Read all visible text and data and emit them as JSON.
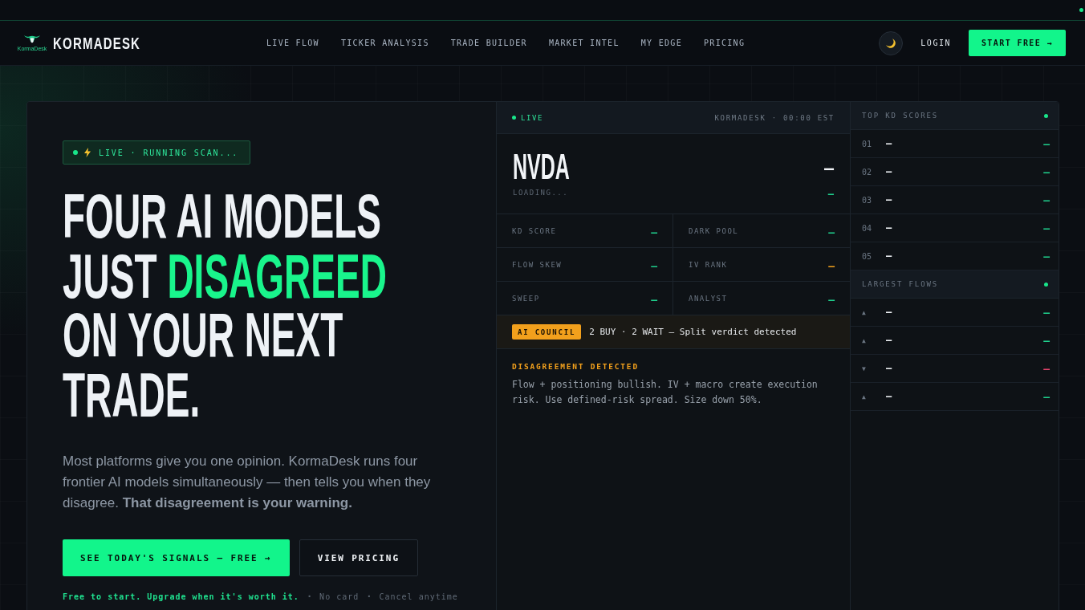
{
  "nav": {
    "logo_caption": "KormaDesk",
    "brand": "KORMADESK",
    "links": [
      {
        "label": "LIVE FLOW"
      },
      {
        "label": "TICKER ANALYSIS"
      },
      {
        "label": "TRADE BUILDER"
      },
      {
        "label": "MARKET INTEL"
      },
      {
        "label": "MY EDGE"
      },
      {
        "label": "PRICING"
      }
    ],
    "login": "LOGIN",
    "cta": "START FREE →"
  },
  "hero": {
    "badge": "LIVE · RUNNING SCAN...",
    "headline": [
      {
        "text": "FOUR AI MODELS JUST",
        "highlight": false
      },
      {
        "text": "DISAGREED",
        "highlight": true
      },
      {
        "text": "ON YOUR NEXT TRADE.",
        "highlight": false
      }
    ],
    "description": "Most platforms give you one opinion. KormaDesk runs four frontier AI models simultaneously — then tells you when they disagree. **That disagreement is your warning.**",
    "buttons": [
      {
        "label": "SEE TODAY'S SIGNALS — FREE →",
        "kind": "primary"
      },
      {
        "label": "VIEW PRICING",
        "kind": "secondary"
      }
    ],
    "notes": [
      {
        "text": "Free to start. Upgrade when it's worth it.",
        "kind": "highlight"
      },
      {
        "text": "No card",
        "kind": "muted"
      },
      {
        "text": "Cancel anytime",
        "kind": "muted"
      }
    ],
    "note_separator": "·"
  },
  "ticker_card": {
    "status": "LIVE",
    "source": "KORMADESK · 00:00 EST",
    "symbol": "NVDA",
    "subtitle": "LOADING...",
    "price": "—",
    "change": "—"
  },
  "metrics": [
    {
      "label": "KD SCORE",
      "value": "—",
      "color": "#1fcf8c"
    },
    {
      "label": "DARK POOL",
      "value": "—",
      "color": "#1fcf8c"
    },
    {
      "label": "FLOW SKEW",
      "value": "—",
      "color": "#1fcf8c"
    },
    {
      "label": "IV RANK",
      "value": "—",
      "color": "#f2a01c"
    },
    {
      "label": "SWEEP",
      "value": "—",
      "color": "#1fcf8c"
    },
    {
      "label": "ANALYST",
      "value": "—",
      "color": "#1fcf8c"
    }
  ],
  "council": {
    "badge": "AI COUNCIL",
    "verdict": "2 BUY · 2 WAIT — Split verdict detected"
  },
  "alert": {
    "title": "DISAGREEMENT DETECTED",
    "text": "Flow + positioning bullish. IV + macro create execution risk. Use defined-risk spread. Size down 50%."
  },
  "top_scores": {
    "title": "TOP KD SCORES",
    "rows": [
      {
        "rank": "01",
        "symbol": "—",
        "score": "—"
      },
      {
        "rank": "02",
        "symbol": "—",
        "score": "—"
      },
      {
        "rank": "03",
        "symbol": "—",
        "score": "—"
      },
      {
        "rank": "04",
        "symbol": "—",
        "score": "—"
      },
      {
        "rank": "05",
        "symbol": "—",
        "score": "—"
      }
    ]
  },
  "largest_flows": {
    "title": "LARGEST FLOWS",
    "rows": [
      {
        "arrow": "▲",
        "symbol": "—",
        "value": "—",
        "color": "#1fcf8c"
      },
      {
        "arrow": "▲",
        "symbol": "—",
        "value": "—",
        "color": "#1fcf8c"
      },
      {
        "arrow": "▼",
        "symbol": "—",
        "value": "—",
        "color": "#e0436b"
      },
      {
        "arrow": "▲",
        "symbol": "—",
        "value": "—",
        "color": "#1fcf8c"
      }
    ]
  }
}
